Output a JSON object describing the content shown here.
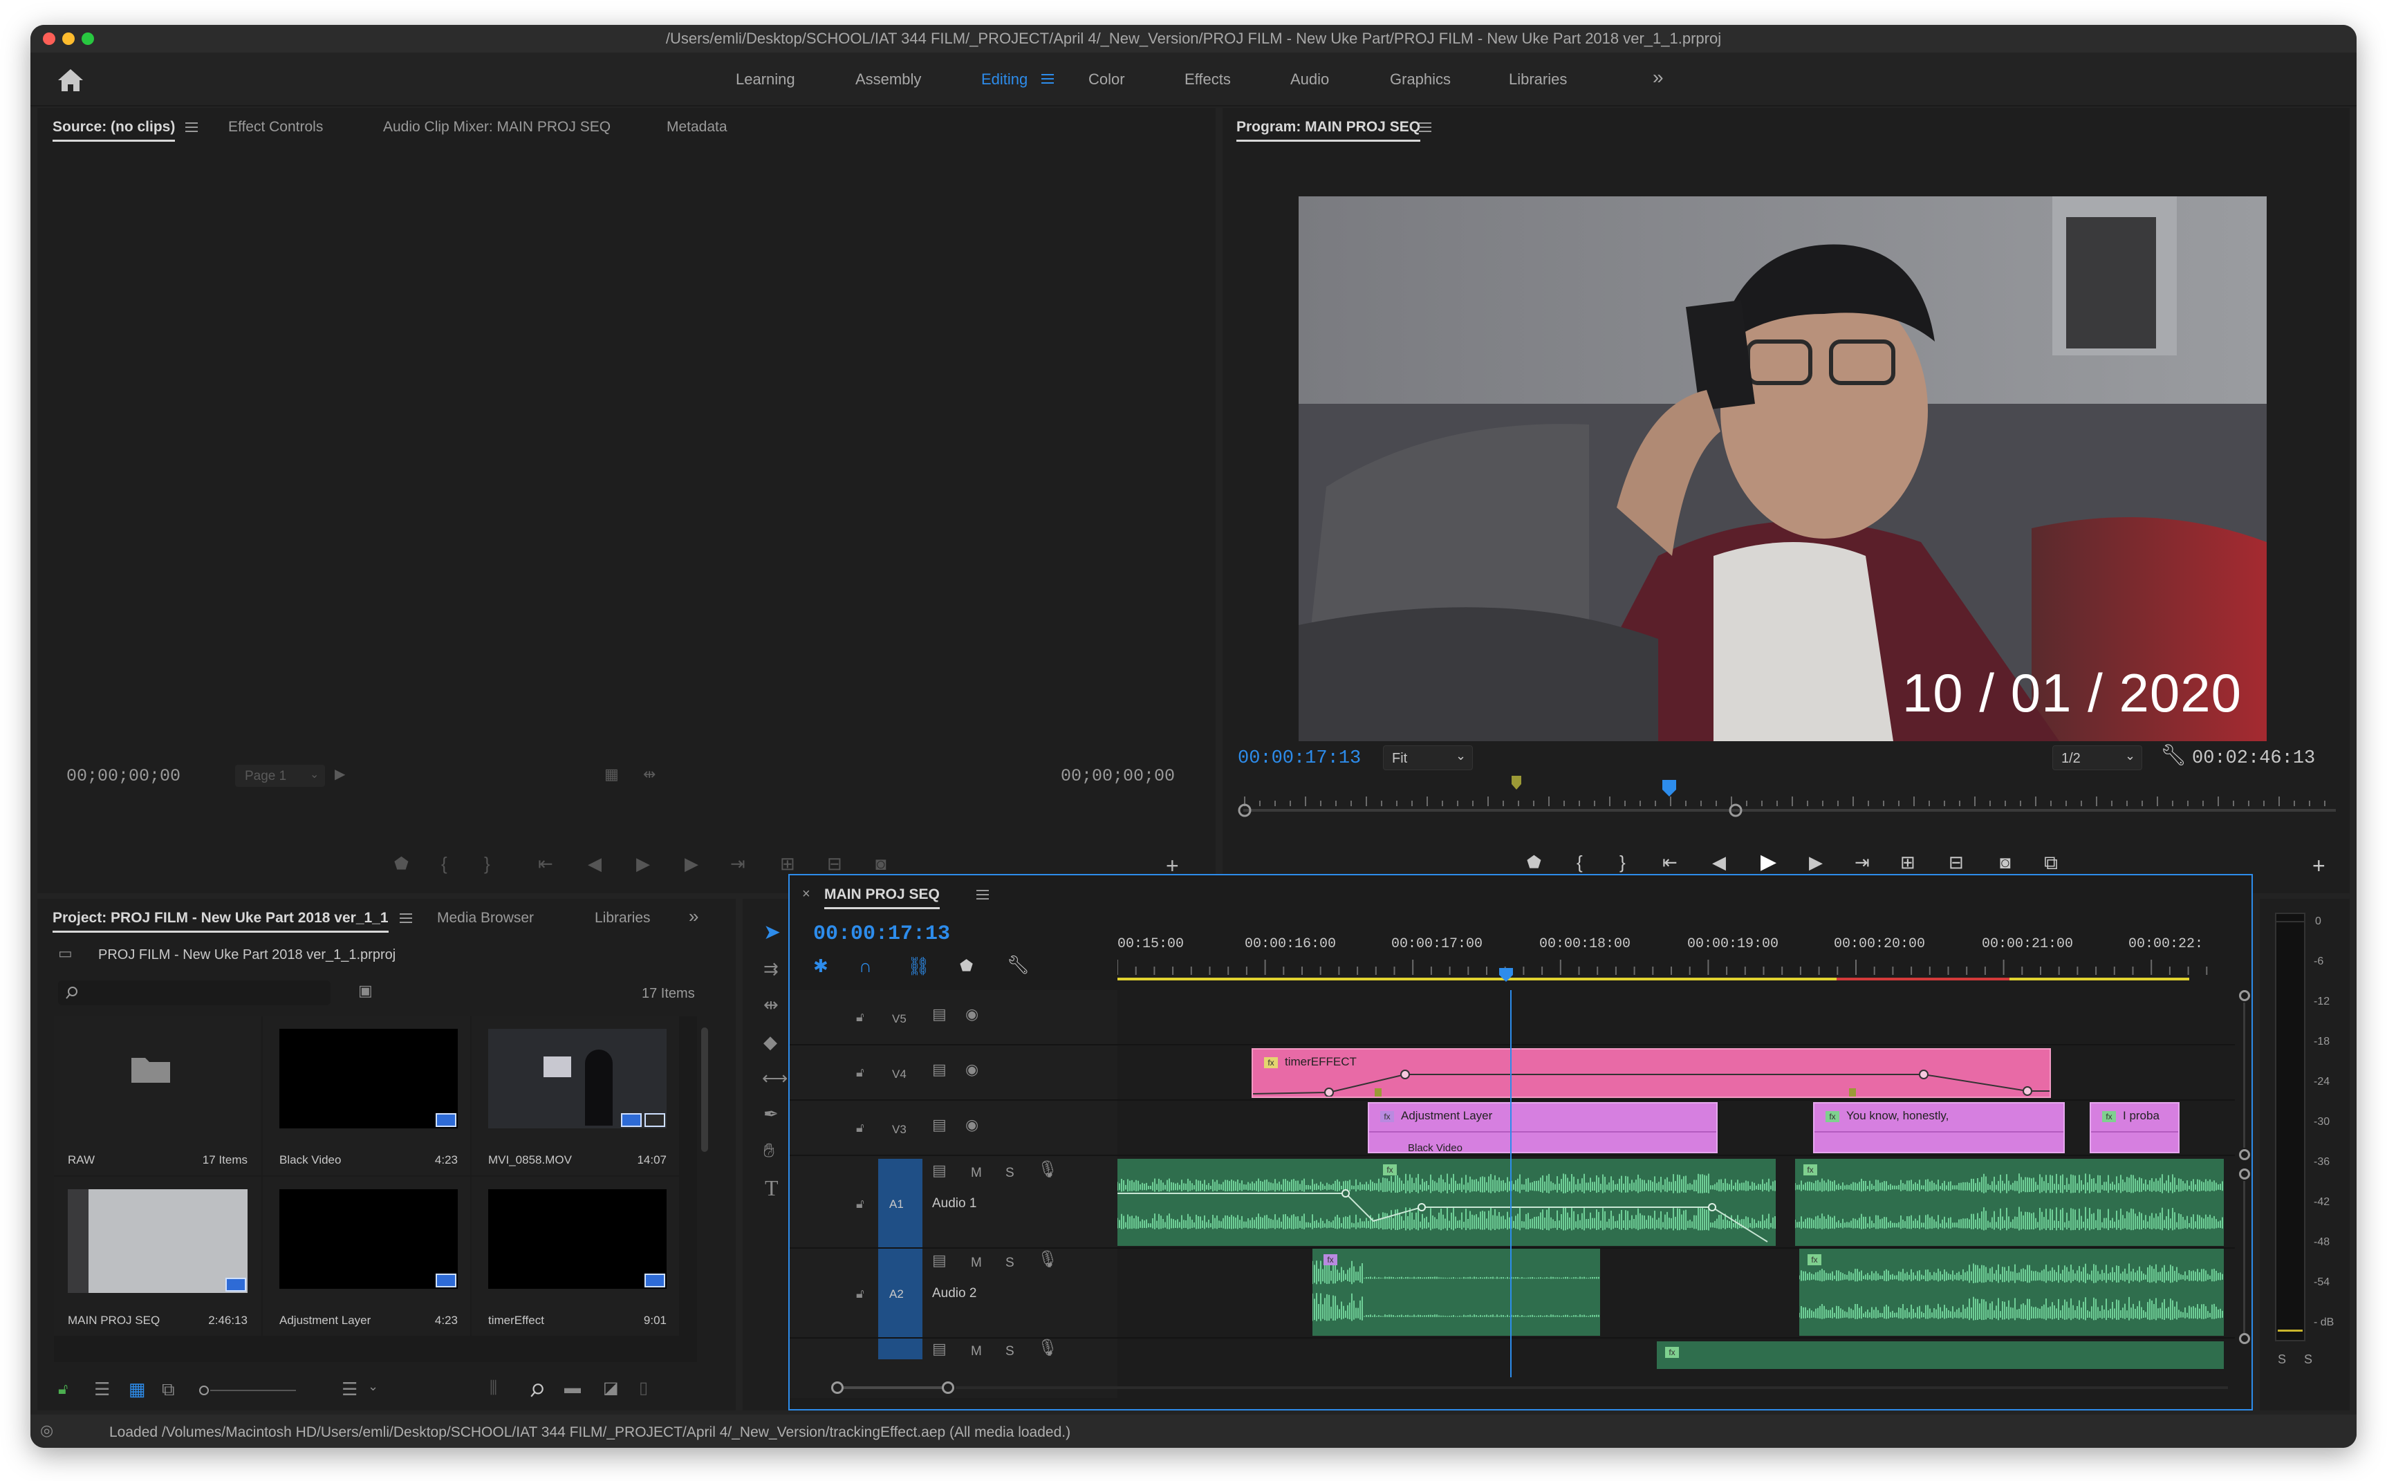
{
  "window": {
    "title": "/Users/emli/Desktop/SCHOOL/IAT 344 FILM/_PROJECT/April 4/_New_Version/PROJ FILM - New Uke Part/PROJ FILM - New Uke Part 2018 ver_1_1.prproj"
  },
  "workspaces": {
    "tabs": [
      "Learning",
      "Assembly",
      "Editing",
      "Color",
      "Effects",
      "Audio",
      "Graphics",
      "Libraries"
    ],
    "active": "Editing",
    "more": "»"
  },
  "source_panel": {
    "tabs": [
      "Source: (no clips)",
      "Effect Controls",
      "Audio Clip Mixer: MAIN PROJ SEQ",
      "Metadata"
    ],
    "timecode_in": "00;00;00;00",
    "timecode_out": "00;00;00;00",
    "page": "Page 1"
  },
  "program_panel": {
    "title": "Program: MAIN PROJ SEQ",
    "timecode": "00:00:17:13",
    "fit": "Fit",
    "resolution": "1/2",
    "duration": "00:02:46:13",
    "overlay_text": "10 / 01 / 2020",
    "playhead_fraction": 0.39
  },
  "project_panel": {
    "tabs": [
      "Project: PROJ FILM - New Uke Part 2018 ver_1_1",
      "Media Browser",
      "Libraries"
    ],
    "file": "PROJ FILM - New Uke Part 2018 ver_1_1.prproj",
    "item_count": "17 Items",
    "items": [
      {
        "name": "RAW",
        "meta": "17 Items"
      },
      {
        "name": "Black Video",
        "meta": "4:23"
      },
      {
        "name": "MVI_0858.MOV",
        "meta": "14:07"
      },
      {
        "name": "MAIN PROJ SEQ",
        "meta": "2:46:13"
      },
      {
        "name": "Adjustment Layer",
        "meta": "4:23"
      },
      {
        "name": "timerEffect",
        "meta": "9:01"
      }
    ]
  },
  "timeline": {
    "title": "MAIN PROJ SEQ",
    "timecode": "00:00:17:13",
    "ruler": [
      "00:15:00",
      "00:00:16:00",
      "00:00:17:00",
      "00:00:18:00",
      "00:00:19:00",
      "00:00:20:00",
      "00:00:21:00",
      "00:00:22:"
    ],
    "tracks": {
      "v5": "V5",
      "v4": "V4",
      "v3": "V3",
      "a1": "A1",
      "a2": "A2",
      "audio1": "Audio 1",
      "audio2": "Audio 2"
    },
    "clips": {
      "timer": "timerEFFECT",
      "adjustment": "Adjustment Layer",
      "black": "Black Video",
      "you_know": "You know, honestly,",
      "i_proba": "I proba"
    },
    "controls": {
      "m": "M",
      "s": "S"
    }
  },
  "meter": {
    "scale": [
      "0",
      "-6",
      "-12",
      "-18",
      "-24",
      "-30",
      "-36",
      "-42",
      "-48",
      "-54",
      "- dB"
    ],
    "solo": [
      "S",
      "S"
    ]
  },
  "status": {
    "text": "Loaded /Volumes/Macintosh HD/Users/emli/Desktop/SCHOOL/IAT 344 FILM/_PROJECT/April 4/_New_Version/trackingEffect.aep (All media loaded.)"
  },
  "colors": {
    "accent": "#2d8ceb",
    "clip_pink": "#e86aa6",
    "clip_violet": "#d67fe0",
    "audio_green": "#5cb989",
    "track_blue": "#1f4f86"
  },
  "icons": [
    "home-icon",
    "menu-icon",
    "search-icon",
    "wrench-icon",
    "play-icon",
    "marker-icon",
    "camera-icon",
    "plus-icon",
    "lock-icon",
    "eye-icon",
    "mic-icon",
    "selection-tool-icon",
    "razor-tool-icon",
    "hand-tool-icon",
    "type-tool-icon",
    "pen-tool-icon"
  ]
}
